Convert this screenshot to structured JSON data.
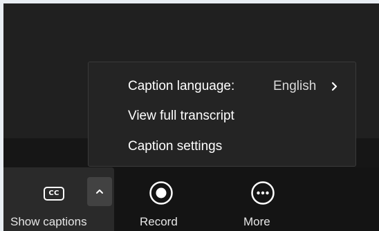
{
  "menu": {
    "items": [
      {
        "label": "Caption language:",
        "value": "English",
        "icon": "chevron-right-icon"
      },
      {
        "label": "View full transcript"
      },
      {
        "label": "Caption settings"
      }
    ]
  },
  "toolbar": {
    "captions": {
      "icon_text": "CC",
      "icon": "closed-captions-icon",
      "label": "Show captions",
      "options_icon": "chevron-up-icon"
    },
    "record": {
      "icon": "record-icon",
      "label": "Record"
    },
    "more": {
      "icon": "more-icon",
      "label": "More"
    }
  },
  "colors": {
    "background": "#202020",
    "toolbar": "#141414",
    "active_group": "#2a2a2a",
    "menu": "#242424",
    "text": "#ffffff"
  }
}
